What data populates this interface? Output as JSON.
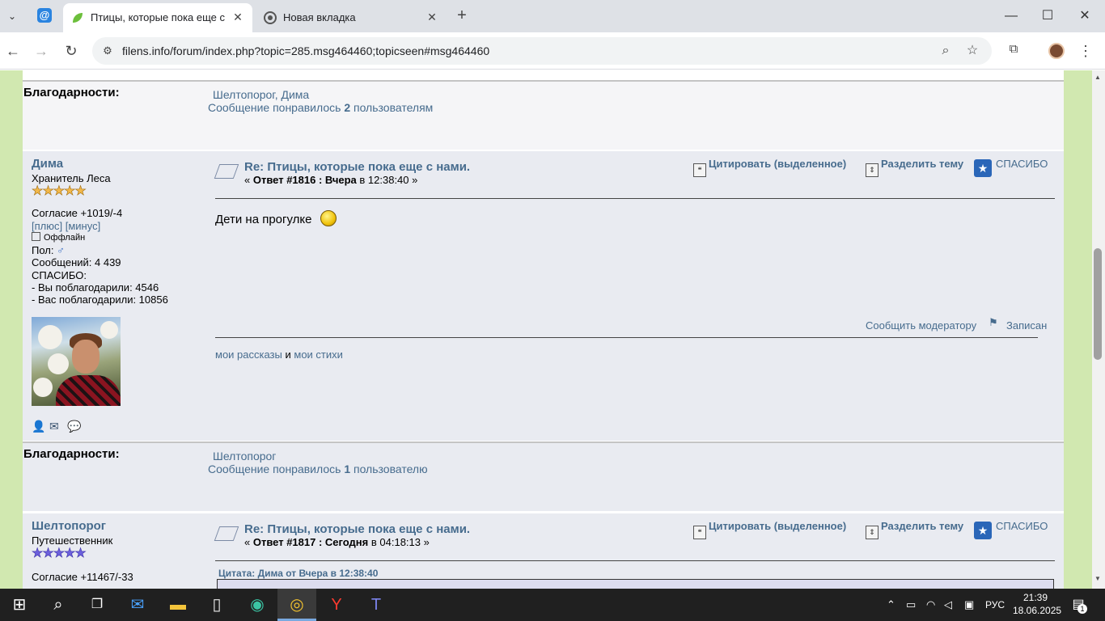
{
  "browser": {
    "tabs": [
      {
        "title": "Птицы, которые пока еще с нами",
        "active": true
      },
      {
        "title": "Новая вкладка",
        "active": false
      }
    ],
    "url": "filens.info/forum/index.php?topic=285.msg464460;topicseen#msg464460",
    "window": {
      "minimize": "—",
      "maximize": "☐",
      "close": "✕"
    }
  },
  "thanks_top": {
    "label": "Благодарности:",
    "names": "Шелтопорог, Дима",
    "liked_prefix": "Сообщение понравилось",
    "liked_count": "2",
    "liked_suffix": "пользователям"
  },
  "post1": {
    "author": {
      "name": "Дима",
      "rank": "Хранитель Леса",
      "stars": "★★★★★",
      "agreement": "Согласие +1019/-4",
      "plus": "[плюс]",
      "minus": "[минус]",
      "status": "Оффлайн",
      "gender": "Пол:",
      "messages": "Сообщений: 4 439",
      "thanks_label": "СПАСИБО:",
      "thanked_by_you": "- Вы поблагодарили: 4546",
      "thanked_you": "- Вас поблагодарили: 10856"
    },
    "subject": "Re: Птицы, которые пока еще с нами.",
    "meta_open": "«",
    "meta_reply": "Ответ #1816 :",
    "meta_day": "Вчера",
    "meta_time": "в 12:38:40",
    "meta_close": "»",
    "quote_btn": "Цитировать (выделенное)",
    "split_btn": "Разделить тему",
    "thanks_btn": "СПАСИБО",
    "body": "Дети на прогулке",
    "report": "Сообщить модератору",
    "logged": "Записан",
    "sig_stories": "мои рассказы",
    "sig_and": "и",
    "sig_poems": "мои стихи"
  },
  "thanks_mid": {
    "label": "Благодарности:",
    "names": "Шелтопорог",
    "liked_prefix": "Сообщение понравилось",
    "liked_count": "1",
    "liked_suffix": "пользователю"
  },
  "post2": {
    "author": {
      "name": "Шелтопорог",
      "rank": "Путешественник",
      "stars": "★★★★★",
      "agreement": "Согласие +11467/-33"
    },
    "subject": "Re: Птицы, которые пока еще с нами.",
    "meta_open": "«",
    "meta_reply": "Ответ #1817 :",
    "meta_day": "Сегодня",
    "meta_time": "в 04:18:13",
    "meta_close": "»",
    "quote_btn": "Цитировать (выделенное)",
    "split_btn": "Разделить тему",
    "thanks_btn": "СПАСИБО",
    "quote_header": "Цитата: Дима от Вчера в 12:38:40"
  },
  "taskbar": {
    "lang": "РУС",
    "time": "21:39",
    "date": "18.06.2025",
    "notifications": "1"
  }
}
